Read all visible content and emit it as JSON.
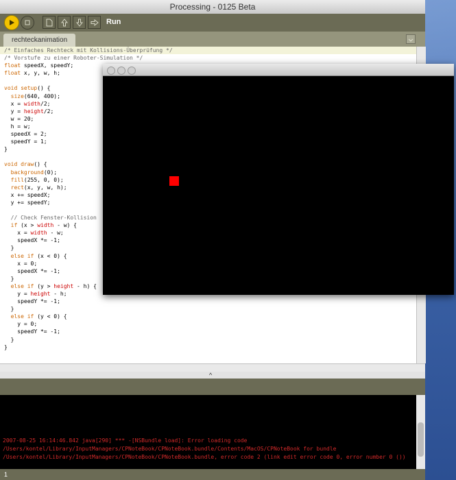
{
  "window": {
    "title": "Processing - 0125 Beta"
  },
  "toolbar": {
    "run_label": "Run"
  },
  "tab": {
    "name": "rechteckanimation"
  },
  "code": [
    "/* Einfaches Rechteck mit Kollisions-Überprüfung */",
    "/* Vorstufe zu einer Roboter-Simulation */",
    "float speedX, speedY;",
    "float x, y, w, h;",
    "",
    "void setup() {",
    "  size(640, 400);",
    "  x = width/2;",
    "  y = height/2;",
    "  w = 20;",
    "  h = w;",
    "  speedX = 2;",
    "  speedY = 1;",
    "}",
    "",
    "void draw() {",
    "  background(0);",
    "  fill(255, 0, 0);",
    "  rect(x, y, w, h);",
    "  x += speedX;",
    "  y += speedY;",
    "",
    "  // Check Fenster-Kollision",
    "  if (x > width - w) {",
    "    x = width - w;",
    "    speedX *= -1;",
    "  }",
    "  else if (x < 0) {",
    "    x = 0;",
    "    speedX *= -1;",
    "  }",
    "  else if (y > height - h) {",
    "    y = height - h;",
    "    speedY *= -1;",
    "  }",
    "  else if (y < 0) {",
    "    y = 0;",
    "    speedY *= -1;",
    "  }",
    "}"
  ],
  "console": {
    "lines": [
      "2007-08-25 16:14:46.842 java[290] *** -[NSBundle load]: Error loading code",
      "/Users/kontel/Library/InputManagers/CPNoteBook/CPNoteBook.bundle/Contents/MacOS/CPNoteBook for bundle",
      "/Users/kontel/Library/InputManagers/CPNoteBook/CPNoteBook.bundle, error code 2 (link edit error code 0, error number 0 ())"
    ]
  },
  "status": {
    "line_number": "1"
  },
  "divider": {
    "arrow": "^"
  },
  "colors": {
    "toolbar": "#6b6b55",
    "run_button": "#f3c200",
    "console_text": "#d42a2a",
    "sketch_rect": "#ff0000"
  }
}
